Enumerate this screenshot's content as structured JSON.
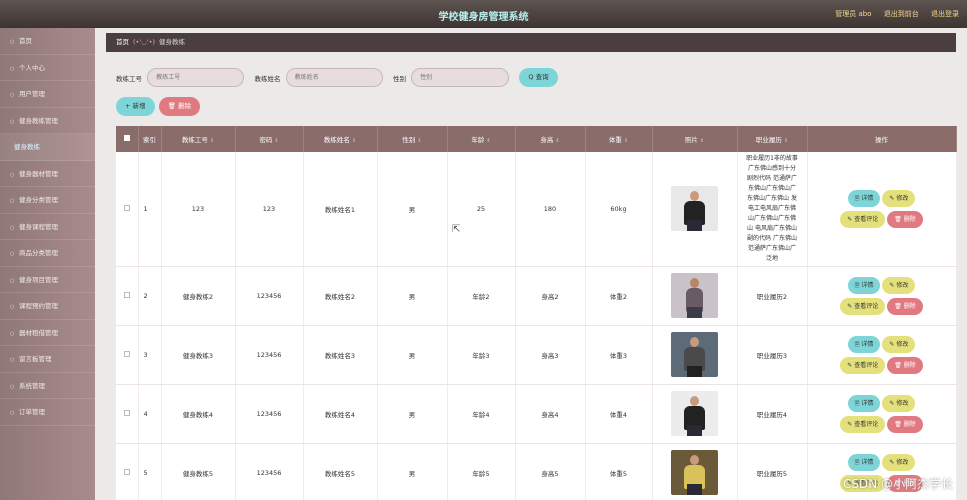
{
  "header": {
    "title": "学校健身房管理系统",
    "user_label": "管理员 abo",
    "to_front": "退出到前台",
    "logout": "退出登录"
  },
  "sidebar": {
    "items": [
      {
        "label": "首页"
      },
      {
        "label": "个人中心"
      },
      {
        "label": "用户管理"
      },
      {
        "label": "健身教练管理"
      },
      {
        "label": "健身教练",
        "active": true
      },
      {
        "label": "健身器材管理"
      },
      {
        "label": "健身分类管理"
      },
      {
        "label": "健身课程管理"
      },
      {
        "label": "商品分类管理"
      },
      {
        "label": "健身项目管理"
      },
      {
        "label": "课程预约管理"
      },
      {
        "label": "器材租借管理"
      },
      {
        "label": "留言板管理"
      },
      {
        "label": "系统管理"
      },
      {
        "label": "订单管理"
      }
    ]
  },
  "breadcrumb": {
    "home": "首页",
    "face": "(•'◡'•)",
    "current": "健身教练"
  },
  "search": {
    "coach_no_label": "教练工号",
    "coach_no_placeholder": "教练工号",
    "coach_name_label": "教练姓名",
    "coach_name_placeholder": "教练姓名",
    "gender_label": "性别",
    "gender_placeholder": "性别",
    "query_button": "Q 查询"
  },
  "actions": {
    "add": "+ 新增",
    "delete": "🗑 删除"
  },
  "table": {
    "headers": [
      "索引",
      "教练工号",
      "密码",
      "教练姓名",
      "性别",
      "年龄",
      "身高",
      "体重",
      "照片",
      "职业履历",
      "操作"
    ],
    "rows": [
      {
        "index": "1",
        "coach_no": "123",
        "password": "123",
        "name": "教练姓名1",
        "gender": "男",
        "age": "25",
        "height": "180",
        "weight": "60kg",
        "resume": "职业履历1非的故事广东佛山感到十分剧烈代码 范通萨广东佛山广东佛山广东佛山广东佛山 发电工电风扇广东佛山广东佛山广东佛山 电风扇广东佛山副的代码 广东佛山 范通萨广东佛山广泛地"
      },
      {
        "index": "2",
        "coach_no": "健身教练2",
        "password": "123456",
        "name": "教练姓名2",
        "gender": "男",
        "age": "年龄2",
        "height": "身高2",
        "weight": "体重2",
        "resume": "职业履历2"
      },
      {
        "index": "3",
        "coach_no": "健身教练3",
        "password": "123456",
        "name": "教练姓名3",
        "gender": "男",
        "age": "年龄3",
        "height": "身高3",
        "weight": "体重3",
        "resume": "职业履历3"
      },
      {
        "index": "4",
        "coach_no": "健身教练4",
        "password": "123456",
        "name": "教练姓名4",
        "gender": "男",
        "age": "年龄4",
        "height": "身高4",
        "weight": "体重4",
        "resume": "职业履历4"
      },
      {
        "index": "5",
        "coach_no": "健身教练5",
        "password": "123456",
        "name": "教练姓名5",
        "gender": "男",
        "age": "年龄5",
        "height": "身高5",
        "weight": "体重5",
        "resume": "职业履历5"
      }
    ],
    "ops": {
      "detail": "🗎 详情",
      "edit": "✎ 修改",
      "review": "✎ 查看评论",
      "remove": "🗑 删除"
    }
  },
  "watermark": "CSDN @小阿杰学长",
  "colors": {
    "sidebar": "#a88c8b",
    "header_row": "#8a6c6b",
    "accent_cyan": "#7dd5d8",
    "accent_yellow": "#e4e07c",
    "danger": "#e07a80"
  }
}
